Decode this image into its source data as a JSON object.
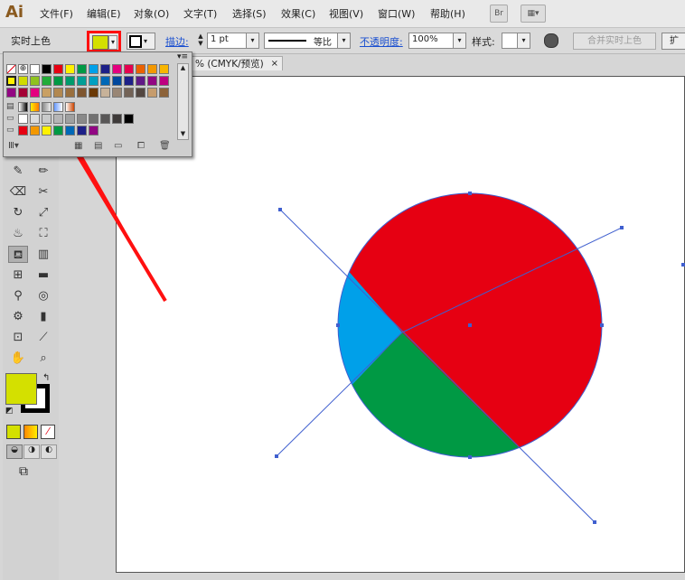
{
  "app": {
    "logo": "Ai"
  },
  "menu": [
    "文件(F)",
    "编辑(E)",
    "对象(O)",
    "文字(T)",
    "选择(S)",
    "效果(C)",
    "视图(V)",
    "窗口(W)",
    "帮助(H)"
  ],
  "menubar_buttons": {
    "bridge": "Br"
  },
  "control_bar": {
    "selection_label": "实时上色",
    "stroke_label": "描边:",
    "stroke_weight": "1 pt",
    "profile_label": "等比",
    "opacity_label": "不透明度:",
    "opacity_value": "100%",
    "style_label": "样式:",
    "merge_button": "合并实时上色",
    "fill_color": "#d4e000"
  },
  "document_tab": {
    "title": "% (CMYK/预览)",
    "close": "×"
  },
  "tools": [
    "paintbrush-icon",
    "pencil-icon",
    "blob-brush-icon",
    "scissors-icon",
    "rotate-icon",
    "scale-icon",
    "warp-icon",
    "free-transform-icon",
    "live-paint-bucket-icon",
    "perspective-grid-icon",
    "mesh-icon",
    "gradient-icon",
    "eyedropper-icon",
    "blend-icon",
    "symbol-sprayer-icon",
    "column-graph-icon",
    "artboard-icon",
    "slice-icon",
    "hand-icon",
    "zoom-icon"
  ],
  "swatch_panel": {
    "rows": [
      [
        "none",
        "registration",
        "#ffffff",
        "#000000",
        "#e60012",
        "#fff100",
        "#009944",
        "#00a0e9",
        "#1d2088",
        "#e4007f",
        "#e5004f",
        "#eb6100",
        "#f39800",
        "#f8b500"
      ],
      [
        "#fff100",
        "#cfdb00",
        "#8fc31f",
        "#22ac38",
        "#009944",
        "#009b6b",
        "#009e96",
        "#00a0c1",
        "#0068b7",
        "#00479d",
        "#1d2088",
        "#601986",
        "#920783",
        "#be0081"
      ],
      [
        "#920783",
        "#a40035",
        "#e4007f",
        "#c9a063",
        "#b28850",
        "#9a6f3d",
        "#7f5630",
        "#6a3906",
        "#c7b299",
        "#998675",
        "#736357",
        "#534741",
        "#c69c6d",
        "#8c6239"
      ],
      [
        "#ffffff",
        "#dcdddd",
        "#c9caca",
        "#b5b5b6",
        "#9fa0a0",
        "#898989",
        "#727171",
        "#595757",
        "#3e3a39",
        "#000000"
      ],
      [
        "#e60012",
        "#f39800",
        "#fff100",
        "#009944",
        "#0068b7",
        "#1d2088",
        "#920783"
      ]
    ]
  },
  "colors": {
    "red": "#e60012",
    "green": "#009944",
    "blue": "#00a0e9",
    "guide": "#3f5fcf",
    "annotation_red": "#ff1010",
    "fill": "#d4e000"
  }
}
